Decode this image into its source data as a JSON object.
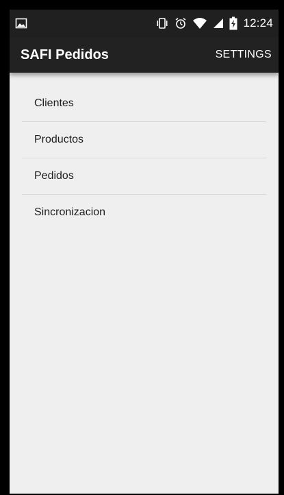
{
  "status_bar": {
    "time": "12:24",
    "icons": [
      "image-notification-icon",
      "vibrate-icon",
      "alarm-icon",
      "wifi-icon",
      "signal-icon",
      "battery-charging-icon"
    ]
  },
  "app_bar": {
    "title": "SAFI Pedidos",
    "settings_label": "SETTINGS"
  },
  "menu": {
    "items": [
      {
        "label": "Clientes"
      },
      {
        "label": "Productos"
      },
      {
        "label": "Pedidos"
      },
      {
        "label": "Sincronizacion"
      }
    ]
  },
  "colors": {
    "app_bar": "#222222",
    "status_bar": "#202020",
    "content_background": "#efefef",
    "divider": "#d6d6d6",
    "text": "#1d1d1d"
  }
}
